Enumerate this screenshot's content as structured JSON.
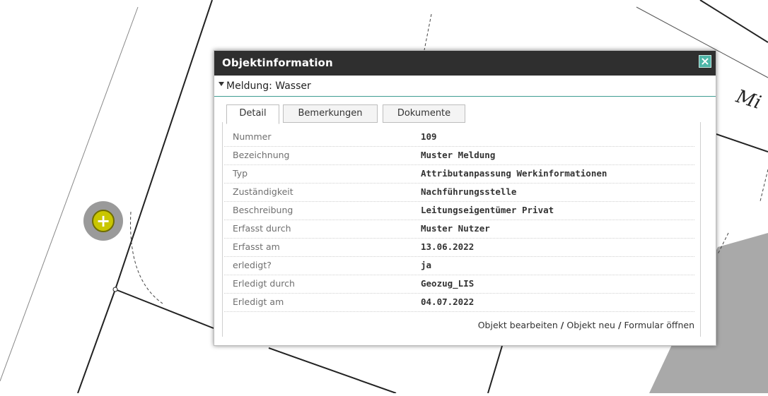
{
  "popup": {
    "title": "Objektinformation",
    "close_label": "×",
    "section_label": "Meldung: Wasser",
    "tabs": [
      {
        "label": "Detail",
        "active": true
      },
      {
        "label": "Bemerkungen",
        "active": false
      },
      {
        "label": "Dokumente",
        "active": false
      }
    ],
    "rows": [
      {
        "label": "Nummer",
        "value": "109"
      },
      {
        "label": "Bezeichnung",
        "value": "Muster Meldung"
      },
      {
        "label": "Typ",
        "value": "Attributanpassung Werkinformationen"
      },
      {
        "label": "Zuständigkeit",
        "value": "Nachführungsstelle"
      },
      {
        "label": "Beschreibung",
        "value": "Leitungseigentümer Privat"
      },
      {
        "label": "Erfasst durch",
        "value": "Muster Nutzer"
      },
      {
        "label": "Erfasst am",
        "value": "13.06.2022"
      },
      {
        "label": "erledigt?",
        "value": "ja"
      },
      {
        "label": "Erledigt durch",
        "value": "Geozug_LIS"
      },
      {
        "label": "Erledigt am",
        "value": "04.07.2022"
      }
    ],
    "actions": {
      "edit": "Objekt bearbeiten",
      "new": "Objekt neu",
      "form": "Formular öffnen",
      "separator": "/"
    }
  },
  "map": {
    "label_partial_1": "Mi",
    "marker_icon": "add-icon"
  },
  "colors": {
    "titlebar": "#2f2f2f",
    "close_button": "#4fb6a8",
    "marker": "#c9c600",
    "section_line": "#3f9c92"
  }
}
